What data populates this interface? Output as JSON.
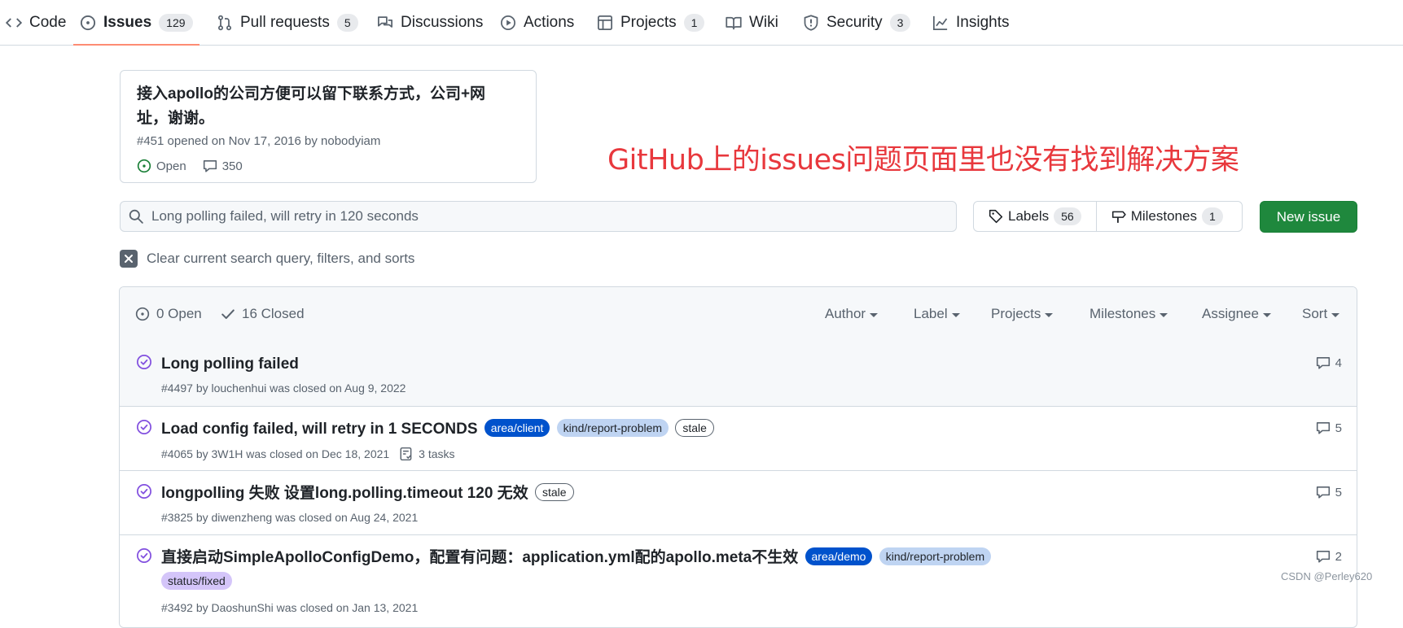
{
  "nav": {
    "tabs": [
      {
        "label": "Code"
      },
      {
        "label": "Issues",
        "count": "129"
      },
      {
        "label": "Pull requests",
        "count": "5"
      },
      {
        "label": "Discussions"
      },
      {
        "label": "Actions"
      },
      {
        "label": "Projects",
        "count": "1"
      },
      {
        "label": "Wiki"
      },
      {
        "label": "Security",
        "count": "3"
      },
      {
        "label": "Insights"
      }
    ]
  },
  "pinned": {
    "title": "接入apollo的公司方便可以留下联系方式，公司+网址，谢谢。",
    "meta": "#451 opened on Nov 17, 2016 by nobodyiam",
    "status": "Open",
    "comments": "350"
  },
  "annotation": "GitHub上的issues问题页面里也没有找到解决方案",
  "search": {
    "value": "Long polling failed, will retry in 120 seconds"
  },
  "labels_button": {
    "label": "Labels",
    "count": "56"
  },
  "milestones_button": {
    "label": "Milestones",
    "count": "1"
  },
  "new_issue": "New issue",
  "clear_filters": "Clear current search query, filters, and sorts",
  "list_header": {
    "open": "0 Open",
    "closed": "16 Closed",
    "filters": [
      "Author",
      "Label",
      "Projects",
      "Milestones",
      "Assignee",
      "Sort"
    ]
  },
  "issues": [
    {
      "title": "Long polling failed",
      "labels": [],
      "meta": "#4497 by louchenhui was closed on Aug 9, 2022",
      "tasks": "",
      "comments": "4"
    },
    {
      "title": "Load config failed, will retry in 1 SECONDS",
      "labels": [
        "area/client",
        "kind/report-problem",
        "stale"
      ],
      "meta": "#4065 by 3W1H was closed on Dec 18, 2021",
      "tasks": "3 tasks",
      "comments": "5"
    },
    {
      "title": "longpolling 失败 设置long.polling.timeout 120 无效",
      "labels": [
        "stale"
      ],
      "meta": "#3825 by diwenzheng was closed on Aug 24, 2021",
      "tasks": "",
      "comments": "5"
    },
    {
      "title": "直接启动SimpleApolloConfigDemo，配置有问题：application.yml配的apollo.meta不生效",
      "labels": [
        "area/demo",
        "kind/report-problem",
        "status/fixed"
      ],
      "meta": "#3492 by DaoshunShi was closed on Jan 13, 2021",
      "tasks": "",
      "comments": "2"
    }
  ],
  "label_colors": {
    "area/client": "#0052cc",
    "area/demo": "#0052cc",
    "kind/report-problem": "#bfd4f2",
    "stale": "#ffffff",
    "status/fixed": "#d4c5f9"
  },
  "accent_colors": {
    "primary_button": "#1f883d",
    "active_tab_underline": "#fd8c73",
    "annotation_text": "#e8383d"
  },
  "watermark": "CSDN @Perley620"
}
